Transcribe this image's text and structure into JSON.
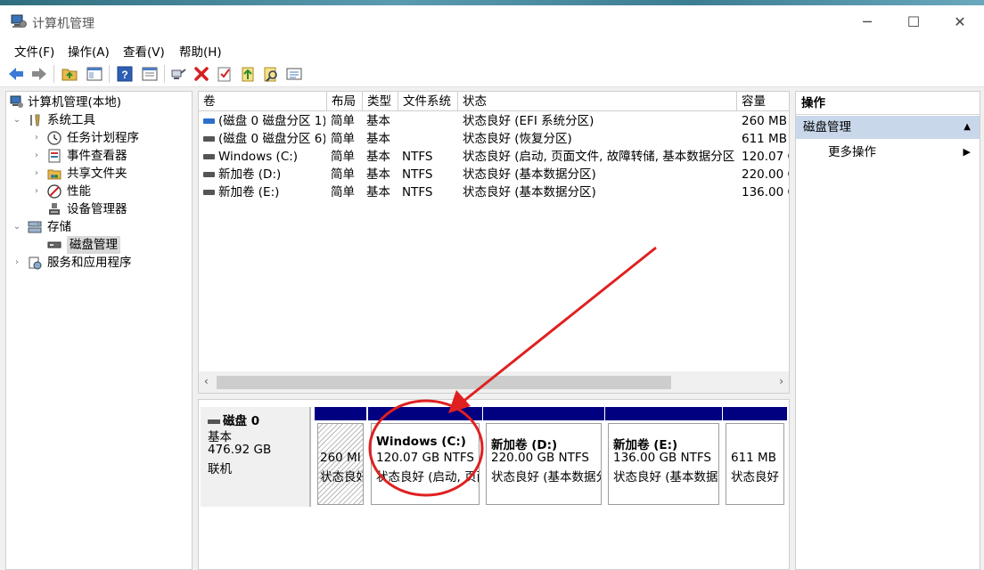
{
  "window": {
    "title": "计算机管理",
    "controls": {
      "minimize": "─",
      "maximize": "☐",
      "close": "✕"
    }
  },
  "menu": [
    "文件(F)",
    "操作(A)",
    "查看(V)",
    "帮助(H)"
  ],
  "toolbar_icons": [
    "back-icon",
    "forward-icon",
    "up-folder-icon",
    "show-hide-tree-icon",
    "help-icon",
    "properties-icon",
    "connect-icon",
    "delete-icon",
    "check-icon",
    "import-icon",
    "search-icon",
    "list-icon"
  ],
  "tree": {
    "root": "计算机管理(本地)",
    "system_tools": "系统工具",
    "task_scheduler": "任务计划程序",
    "event_viewer": "事件查看器",
    "shared_folders": "共享文件夹",
    "performance": "性能",
    "device_manager": "设备管理器",
    "storage": "存储",
    "disk_management": "磁盘管理",
    "services_apps": "服务和应用程序"
  },
  "volume_table": {
    "headers": [
      "卷",
      "布局",
      "类型",
      "文件系统",
      "状态",
      "容量"
    ],
    "rows": [
      {
        "volume": "(磁盘 0 磁盘分区 1)",
        "layout": "简单",
        "type": "基本",
        "fs": "",
        "status": "状态良好 (EFI 系统分区)",
        "capacity": "260 MB",
        "icon": "blue"
      },
      {
        "volume": "(磁盘 0 磁盘分区 6)",
        "layout": "简单",
        "type": "基本",
        "fs": "",
        "status": "状态良好 (恢复分区)",
        "capacity": "611 MB",
        "icon": "gray"
      },
      {
        "volume": "Windows (C:)",
        "layout": "简单",
        "type": "基本",
        "fs": "NTFS",
        "status": "状态良好 (启动, 页面文件, 故障转储, 基本数据分区)",
        "capacity": "120.07 G",
        "icon": "gray"
      },
      {
        "volume": "新加卷 (D:)",
        "layout": "简单",
        "type": "基本",
        "fs": "NTFS",
        "status": "状态良好 (基本数据分区)",
        "capacity": "220.00 G",
        "icon": "gray"
      },
      {
        "volume": "新加卷 (E:)",
        "layout": "简单",
        "type": "基本",
        "fs": "NTFS",
        "status": "状态良好 (基本数据分区)",
        "capacity": "136.00 G",
        "icon": "gray"
      }
    ],
    "scroll_left": "‹",
    "scroll_right": "›"
  },
  "disk": {
    "name": "磁盘 0",
    "type": "基本",
    "size": "476.92 GB",
    "state": "联机",
    "partitions": [
      {
        "title": "",
        "size": "260 MI",
        "status": "状态良好"
      },
      {
        "title": "Windows  (C:)",
        "size": "120.07 GB NTFS",
        "status": "状态良好 (启动, 页面"
      },
      {
        "title": "新加卷  (D:)",
        "size": "220.00 GB NTFS",
        "status": "状态良好 (基本数据分"
      },
      {
        "title": "新加卷  (E:)",
        "size": "136.00 GB NTFS",
        "status": "状态良好 (基本数据"
      },
      {
        "title": "",
        "size": "611 MB",
        "status": "状态良好"
      }
    ]
  },
  "actions": {
    "header": "操作",
    "section": "磁盘管理",
    "section_toggle": "▲",
    "more": "更多操作",
    "more_arrow": "▶"
  },
  "annotation": {
    "circle_color": "#e02020",
    "arrow_color": "#e02020"
  }
}
